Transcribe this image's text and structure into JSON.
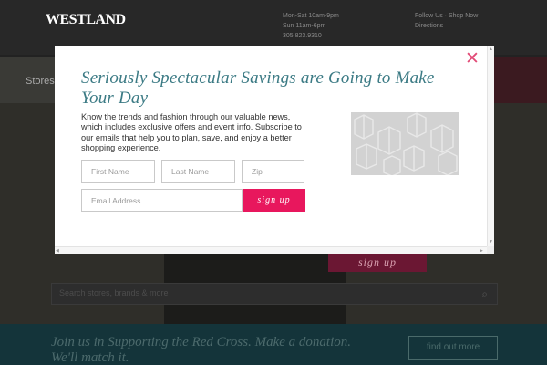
{
  "background": {
    "logo": "WESTLAND",
    "contact_lines": [
      "Mon-Sat 10am-9pm",
      "Sun 11am-6pm",
      "305.823.9310"
    ],
    "social_lines": [
      "Follow Us  ·  Shop Now",
      "Directions"
    ],
    "nav_first_item": "Stores",
    "nav_promo": "",
    "hero_button": "sign up",
    "search_placeholder": "Search stores, brands & more",
    "redcross_text": "Join us in Supporting the Red Cross. Make a donation. We'll match it.",
    "find_out_more": "find out more"
  },
  "modal": {
    "headline": "Seriously Spectacular Savings are Going to Make Your Day",
    "body": "Know the trends and fashion through our valuable news, which includes exclusive offers and event info. Subscribe to our emails that help you to plan, save, and enjoy a better shopping experience.",
    "fields": {
      "first_name": "First Name",
      "last_name": "Last Name",
      "zip": "Zip",
      "email": "Email Address"
    },
    "signup_label": "sign up",
    "close_glyph": "✕"
  },
  "icons": {
    "close": "close-icon",
    "search": "search-icon"
  },
  "colors": {
    "accent_pink": "#e8175d",
    "headline_teal": "#3b7a84",
    "close_pink": "#e24b77",
    "overlay": "#222222"
  }
}
